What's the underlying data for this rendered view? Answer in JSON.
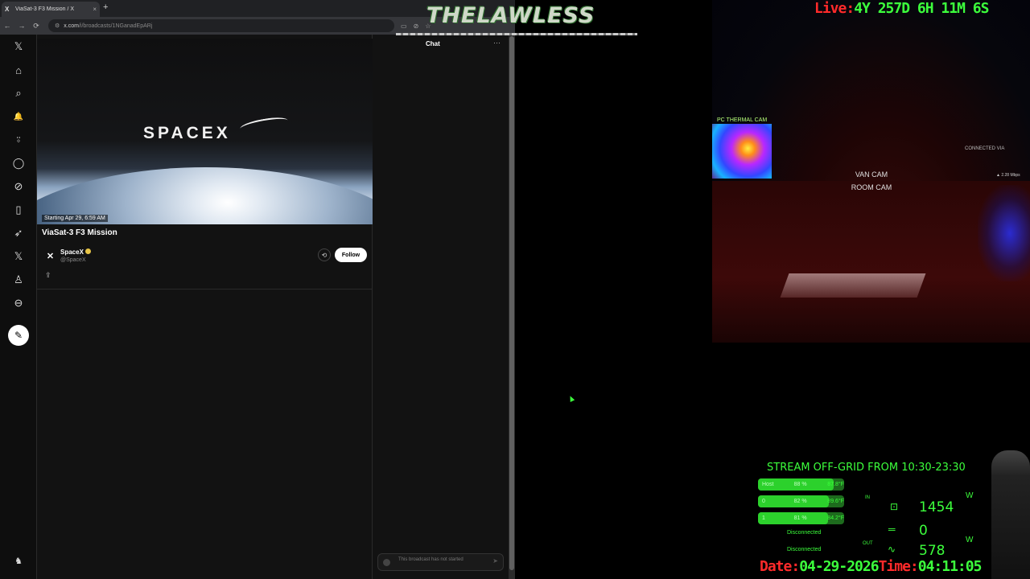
{
  "browser": {
    "tab_title": "ViaSat-3 F3 Mission / X",
    "tab_close": "×",
    "new_tab": "+",
    "url_domain": "x.com",
    "url_path": "/i/broadcasts/1NGanadEpARj",
    "nav_back": "←",
    "nav_forward": "→",
    "nav_reload": "⟳"
  },
  "sidebar": {
    "x_logo": "𝕏",
    "home": "⌂",
    "explore": "⌕",
    "notifications": "🔔",
    "follow": "⍤",
    "messages": "◯",
    "grok": "⊘",
    "bookmarks": "▯",
    "jobs": "➶",
    "premium": "𝕏",
    "profile": "♙",
    "more": "⊖",
    "compose": "✎"
  },
  "broadcast": {
    "brand": "SPACEX",
    "starting": "Starting Apr 29, 6:59 AM",
    "title": "ViaSat-3 F3 Mission",
    "author_name": "SpaceX",
    "author_handle": "@SpaceX",
    "follow_label": "Follow",
    "retweet_icon": "⟲",
    "share_icon": "⇪"
  },
  "chat": {
    "title": "Chat",
    "more": "···",
    "input_placeholder": "This broadcast has not started",
    "send": "➤"
  },
  "overlay": {
    "brand": "THELAWLESS",
    "live_label": "Live:",
    "live_value": "4Y  257D  6H  11M  6S",
    "thermal_label": "PC THERMAL CAM",
    "van_cam": "VAN CAM",
    "room_cam": "ROOM CAM",
    "connected_via": "CONNECTED VIA",
    "speed": "▲ 2.28 Mbps",
    "offgrid": "STREAM OFF-GRID FROM 10:30-23:30",
    "batteries": [
      {
        "label": "Host",
        "pct": "88 %",
        "fill": 0.88,
        "temp": "87.8°F"
      },
      {
        "label": "0",
        "pct": "82 %",
        "fill": 0.82,
        "temp": "89.6°F"
      },
      {
        "label": "1",
        "pct": "81 %",
        "fill": 0.81,
        "temp": "84.2°F"
      }
    ],
    "disconnected_1": "Disconnected",
    "disconnected_2": "Disconnected",
    "in_label": "IN",
    "out_label": "OUT",
    "power_values": [
      "1454",
      "0",
      "578"
    ],
    "w_unit": "W",
    "date_label": "Date:",
    "date_value": "04-29-2026",
    "time_label": "Time:",
    "time_value": "04:11:05"
  },
  "colors": {
    "accent_green": "#3cff3c",
    "accent_red": "#ff2a2a",
    "bg_dark": "#121212"
  }
}
